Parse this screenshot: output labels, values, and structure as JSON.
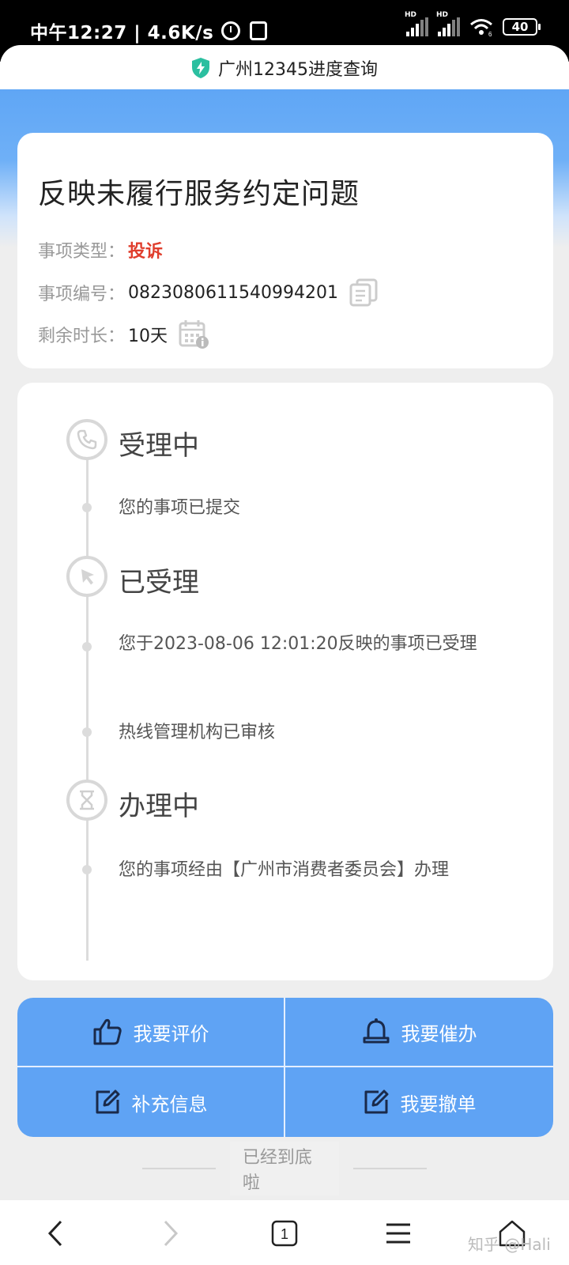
{
  "status_bar": {
    "time_text": "中午12:27 | 4.6K/s",
    "network_label_1": "HD",
    "network_label_2": "HD",
    "wifi_badge": "6",
    "battery": "40"
  },
  "title_bar": {
    "title": "广州12345进度查询",
    "icon": "shield-bolt-icon",
    "icon_color": "#2bbfa0"
  },
  "case": {
    "title": "反映未履行服务约定问题",
    "type_label": "事项类型：",
    "type_value": "投诉",
    "number_label": "事项编号：",
    "number_value": "0823080611540994201",
    "remaining_label": "剩余时长：",
    "remaining_value": "10天"
  },
  "timeline": [
    {
      "stage": "受理中",
      "icon": "phone-icon",
      "events": [
        "您的事项已提交"
      ]
    },
    {
      "stage": "已受理",
      "icon": "cursor-icon",
      "events": [
        "您于2023-08-06 12:01:20反映的事项已受理",
        "热线管理机构已审核"
      ]
    },
    {
      "stage": "办理中",
      "icon": "hourglass-icon",
      "events": [
        "您的事项经由【广州市消费者委员会】办理"
      ]
    }
  ],
  "actions": {
    "evaluate": "我要评价",
    "urge": "我要催办",
    "supplement": "补充信息",
    "withdraw": "我要撤单"
  },
  "footer": {
    "end_text": "已经到底啦"
  },
  "browser_nav": {
    "tab_count": "1",
    "watermark": "知乎 @Hali"
  },
  "colors": {
    "accent_blue": "#5fa3f4",
    "complaint_red": "#e03e2d"
  }
}
